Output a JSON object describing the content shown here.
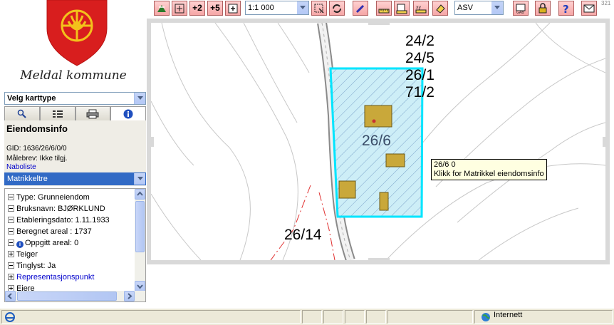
{
  "logo": {
    "title": "Meldal kommune"
  },
  "map_type_select": {
    "value": "Velg karttype"
  },
  "info": {
    "heading": "Eiendomsinfo",
    "gid": "GID: 1636/26/6/0/0",
    "malebrev": "Målebrev: Ikke tilgj.",
    "naboliste": "Naboliste"
  },
  "layer_select": {
    "value": "Matrikkeltre"
  },
  "tree": [
    {
      "label": "Type: Grunneiendom",
      "expanded": true
    },
    {
      "label": "Bruksnavn: BJØRKLUND",
      "expanded": true
    },
    {
      "label": "Etableringsdato: 1.11.1933",
      "expanded": true
    },
    {
      "label": "Beregnet areal : 1737",
      "expanded": true
    },
    {
      "label": "Oppgitt areal: 0",
      "expanded": true
    },
    {
      "label": "Teiger",
      "expanded": false
    },
    {
      "label": "Tinglyst: Ja",
      "expanded": true
    },
    {
      "label": "Representasjonspunkt",
      "expanded": false
    },
    {
      "label": "Eiere",
      "expanded": false
    }
  ],
  "toolbar": {
    "zoom_in_2": "+2",
    "zoom_in_5": "+5",
    "scale": "1:1 000",
    "layer": "ASV"
  },
  "map": {
    "labels": [
      "24/2",
      "24/5",
      "26/1",
      "71/2",
      "26/6",
      "26/14"
    ],
    "tooltip_line1": "26/6 0",
    "tooltip_line2": "Klikk for Matrikkel eiendomsinfo",
    "corner_number": "321"
  },
  "status": {
    "zone": "Internett"
  },
  "colors": {
    "parcel_border": "#00e5ff",
    "parcel_fill": "#cdeef7",
    "building": "#c9a83a",
    "toolbar_button": "#f5a6a6"
  }
}
